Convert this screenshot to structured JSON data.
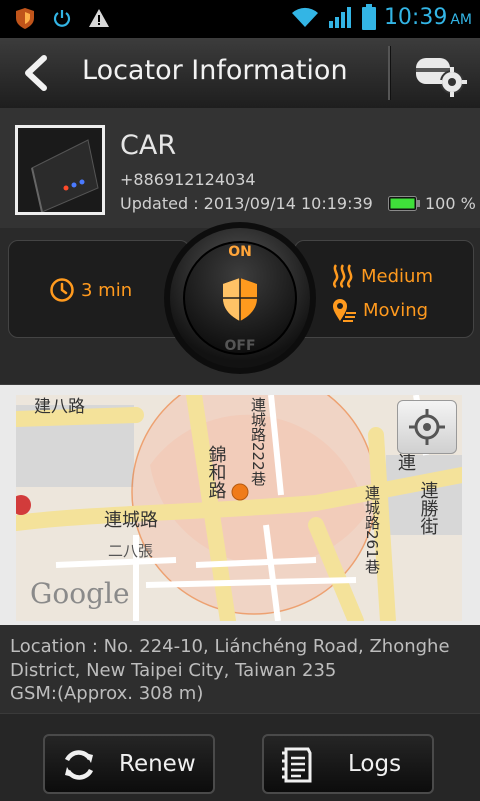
{
  "status_bar": {
    "time": "10:39",
    "ampm": "AM"
  },
  "header": {
    "title": "Locator Information"
  },
  "device": {
    "name": "CAR",
    "phone": "+886912124034",
    "updated": "Updated : 2013/09/14 10:19:39",
    "battery": "100 %",
    "battery_level": 1.0
  },
  "controls": {
    "interval": "3 min",
    "on_label": "ON",
    "off_label": "OFF",
    "sensitivity": "Medium",
    "motion": "Moving"
  },
  "map": {
    "labels": {
      "road1": "建八路",
      "road2": "連城路",
      "road3": "二八張",
      "road4": "錦和路",
      "road5": "連城路222巷",
      "road6": "連城路261巷",
      "road7": "連勝街",
      "road8": "連"
    },
    "provider": "Google"
  },
  "location": {
    "address": "Location : No. 224-10, Liánchéng Road, Zhonghe District, New Taipei City, Taiwan 235",
    "gsm": "GSM:(Approx. 308 m)"
  },
  "actions": {
    "renew_label": "Renew",
    "logs_label": "Logs"
  },
  "colors": {
    "accent_orange": "#ff9a1e",
    "status_blue": "#33b5e5",
    "battery_green": "#3fe03a"
  }
}
